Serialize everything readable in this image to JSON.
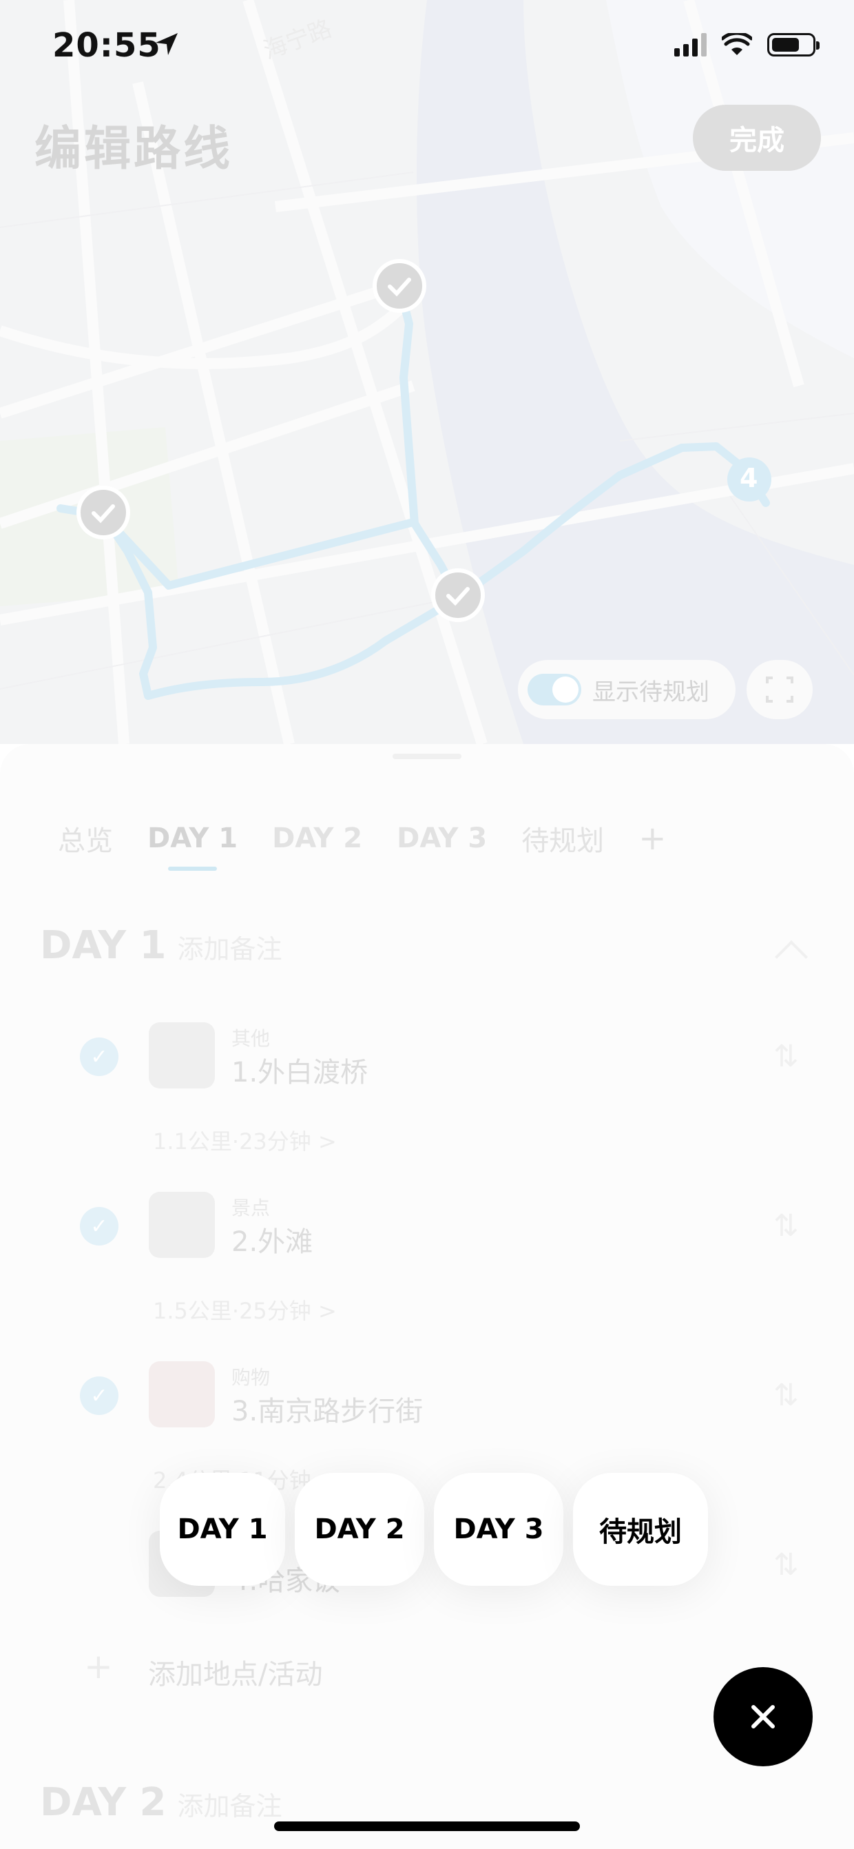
{
  "status": {
    "time": "20:55",
    "battery_level": 0.7,
    "signal_bars": 3
  },
  "header": {
    "title": "编辑路线",
    "done_label": "完成"
  },
  "map": {
    "road_label": "海宁路",
    "route_badge": "4",
    "pending_toggle_label": "显示待规划",
    "pending_toggle_on": true,
    "route_color": "#d8ecf6"
  },
  "tabs": [
    {
      "label": "总览"
    },
    {
      "label": "DAY 1",
      "active": true
    },
    {
      "label": "DAY 2"
    },
    {
      "label": "DAY 3"
    },
    {
      "label": "待规划"
    }
  ],
  "days": [
    {
      "title": "DAY 1",
      "note": "添加备注",
      "stops": [
        {
          "category": "其他",
          "name": "1.外白渡桥",
          "travel": "1.1公里·23分钟 >"
        },
        {
          "category": "景点",
          "name": "2.外滩",
          "travel": "1.5公里·25分钟 >"
        },
        {
          "category": "购物",
          "name": "3.南京路步行街",
          "travel": "2.4公里·11分钟 >"
        },
        {
          "category": "",
          "name": "4.哈家饭"
        }
      ],
      "add_label": "添加地点/活动"
    },
    {
      "title": "DAY 2",
      "note": "添加备注"
    }
  ],
  "picker": {
    "options": [
      "DAY 1",
      "DAY 2",
      "DAY 3",
      "待规划"
    ]
  }
}
